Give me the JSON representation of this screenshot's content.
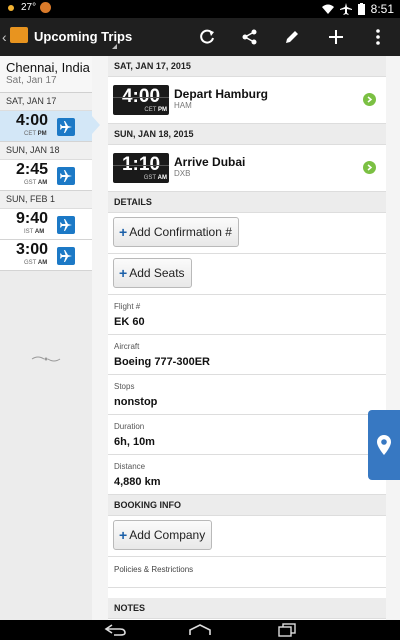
{
  "status_bar": {
    "temperature": "27°",
    "time": "8:51",
    "icons": [
      "weather-icon",
      "notification-icon",
      "wifi-icon",
      "airplane-mode-icon",
      "battery-icon"
    ]
  },
  "action_bar": {
    "title": "Upcoming Trips",
    "actions": [
      "refresh-icon",
      "share-icon",
      "edit-icon",
      "add-icon",
      "overflow-menu-icon"
    ],
    "colors": {
      "background": "#1f1f1f",
      "logo": "#e8941f"
    }
  },
  "trip_list": {
    "destination": "Chennai, India",
    "start_date": "Sat, Jan 17",
    "groups": [
      {
        "date": "SAT, JAN 17",
        "items": [
          {
            "time": "4:00",
            "tz": "CET",
            "ampm": "PM",
            "selected": true
          }
        ]
      },
      {
        "date": "SUN, JAN 18",
        "items": [
          {
            "time": "2:45",
            "tz": "GST",
            "ampm": "AM",
            "selected": false
          }
        ]
      },
      {
        "date": "SUN, FEB 1",
        "items": [
          {
            "time": "9:40",
            "tz": "IST",
            "ampm": "AM",
            "selected": false
          },
          {
            "time": "3:00",
            "tz": "GST",
            "ampm": "AM",
            "selected": false
          }
        ]
      }
    ],
    "colors": {
      "selected": "#d3e7f7",
      "plane_badge": "#1c79c6"
    }
  },
  "detail": {
    "events": [
      {
        "date": "SAT, JAN 17, 2015",
        "time": "4:00",
        "tz": "CET",
        "ampm": "PM",
        "title": "Depart Hamburg",
        "code": "HAM"
      },
      {
        "date": "SUN, JAN 18, 2015",
        "time": "1:10",
        "tz": "GST",
        "ampm": "AM",
        "title": "Arrive Dubai",
        "code": "DXB"
      }
    ],
    "details_header": "DETAILS",
    "add_confirmation_label": "Add Confirmation #",
    "add_seats_label": "Add Seats",
    "fields": [
      {
        "label": "Flight #",
        "value": "EK 60"
      },
      {
        "label": "Aircraft",
        "value": "Boeing 777-300ER"
      },
      {
        "label": "Stops",
        "value": "nonstop"
      },
      {
        "label": "Duration",
        "value": "6h, 10m"
      },
      {
        "label": "Distance",
        "value": "4,880 km"
      }
    ],
    "booking_header": "BOOKING INFO",
    "add_company_label": "Add Company",
    "policies_label": "Policies & Restrictions",
    "notes_header": "NOTES",
    "colors": {
      "go_arrow": "#7bc043",
      "plus": "#1a5fa8"
    }
  },
  "map_button": {
    "icon": "location-pin-icon",
    "color": "#3778c2"
  },
  "nav_bar": {
    "icons": [
      "back-icon",
      "home-icon",
      "recent-apps-icon"
    ]
  }
}
